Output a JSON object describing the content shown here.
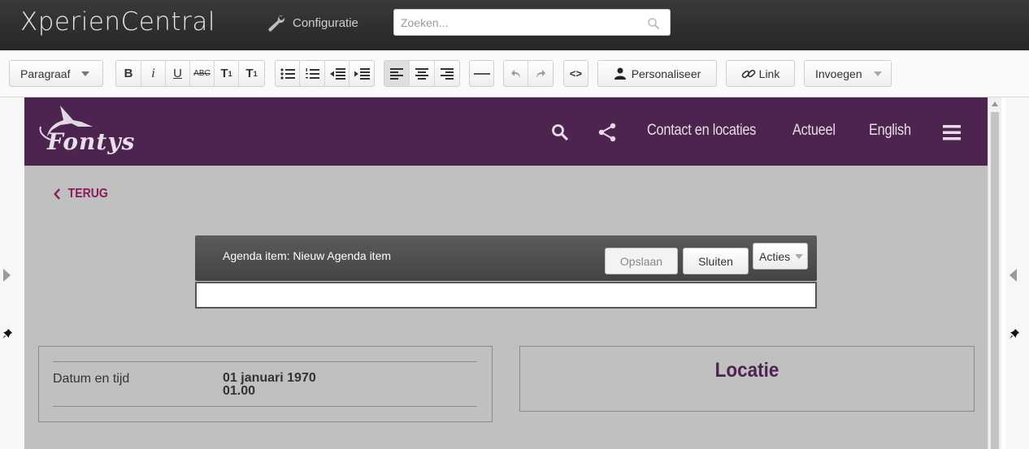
{
  "app": {
    "title": "XperienCentral",
    "config_label": "Configuratie",
    "search_placeholder": "Zoeken..."
  },
  "toolbar": {
    "paragraph_label": "Paragraaf",
    "bold": "B",
    "italic": "i",
    "underline": "U",
    "strike": "ABC",
    "subscript": "T",
    "subscript_mark": "1",
    "superscript": "T",
    "superscript_mark": "1",
    "code": "<>",
    "personalize_label": "Personaliseer",
    "link_label": "Link",
    "insert_label": "Invoegen"
  },
  "site": {
    "brand": "Fontys",
    "nav": [
      "Contact en locaties",
      "Actueel",
      "English"
    ],
    "back_label": "TERUG",
    "accent_color": "#4d2350",
    "link_color": "#8c1a5e"
  },
  "agenda": {
    "title": "Agenda item: Nieuw Agenda item",
    "save_label": "Opslaan",
    "close_label": "Sluiten",
    "actions_label": "Acties",
    "input_value": ""
  },
  "details": {
    "date_label": "Datum en tijd",
    "date_value": "01 januari 1970",
    "time_value": "01.00",
    "location_heading": "Locatie"
  }
}
